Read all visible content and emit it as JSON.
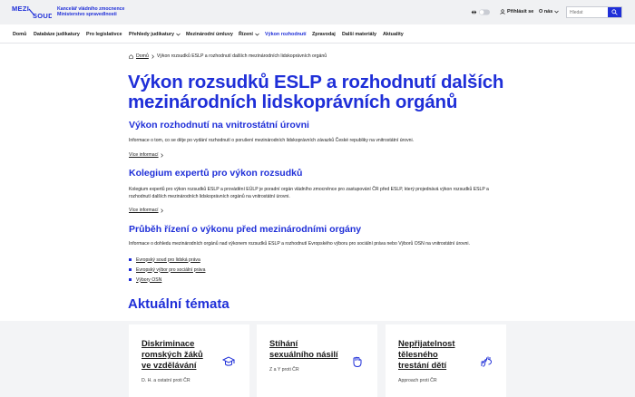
{
  "header": {
    "logo_text": "MEZI — SOUDY",
    "org_line1": "Kancelář vládního zmocnence",
    "org_line2": "Ministerstvo spravedlnosti",
    "login_label": "Přihlásit se",
    "about_label": "O nás",
    "search_placeholder": "Hledat"
  },
  "nav": {
    "items": [
      {
        "label": "Domů",
        "dropdown": false
      },
      {
        "label": "Databáze judikatury",
        "dropdown": false
      },
      {
        "label": "Pro legislativce",
        "dropdown": false
      },
      {
        "label": "Přehledy judikatury",
        "dropdown": true
      },
      {
        "label": "Mezinárodní úmluvy",
        "dropdown": false
      },
      {
        "label": "Řízení",
        "dropdown": true
      },
      {
        "label": "Výkon rozhodnutí",
        "dropdown": false,
        "active": true
      },
      {
        "label": "Zpravodaj",
        "dropdown": false
      },
      {
        "label": "Další materiály",
        "dropdown": false
      },
      {
        "label": "Aktuality",
        "dropdown": false
      }
    ]
  },
  "breadcrumb": {
    "home": "Domů",
    "current": "Výkon rozsudků ESLP a rozhodnutí dalších mezinárodních lidskoprávních orgánů"
  },
  "page": {
    "title": "Výkon rozsudků ESLP a rozhodnutí dalších mezinárodních lidskoprávních orgánů"
  },
  "sections": [
    {
      "heading": "Výkon rozhodnutí na vnitrostátní úrovni",
      "text": "Informace o tom, co se děje po vydání rozhodnutí o porušení mezinárodních lidskoprávních závazků České republiky na vnitrostátní úrovni.",
      "more": "Více informací"
    },
    {
      "heading": "Kolegium expertů pro výkon rozsudků",
      "text": "Kolegium expertů pro výkon rozsudků ESLP a provádění EÚLP je poradní orgán vládního zmocněnce pro zastupování ČR před ESLP, který projednává výkon rozsudků ESLP a rozhodnutí dalších mezinárodních lidskoprávních orgánů na vnitrostátní úrovni.",
      "more": "Více informací"
    },
    {
      "heading": "Průběh řízení o výkonu před mezinárodními orgány",
      "text": "Informace o dohledu mezinárodních orgánů nad výkonem rozsudků ESLP a rozhodnutí Evropského výboru pro sociální práva nebo Výborů OSN na vnitrostátní úrovni.",
      "links": [
        "Evropský soud pro lidská práva",
        "Evropský výbor pro sociální práva",
        "Výbory OSN"
      ]
    }
  ],
  "topics": {
    "heading": "Aktuální témata",
    "cards": [
      {
        "title": "Diskriminace romských žáků ve vzdělávání",
        "subtitle": "D. H. a ostatní proti ČR",
        "icon": "graduation-cap-icon"
      },
      {
        "title": "Stíhání sexuálního násilí",
        "subtitle": "Z a Y proti ČR",
        "icon": "raised-fist-icon"
      },
      {
        "title": "Nepřijatelnost tělesného trestání dětí",
        "subtitle": "Approach proti ČR",
        "icon": "hands-icon"
      }
    ]
  },
  "colors": {
    "accent": "#1f2fd8",
    "topbar_bg": "#f0f1f3",
    "cards_bg": "#f3f4f6"
  }
}
